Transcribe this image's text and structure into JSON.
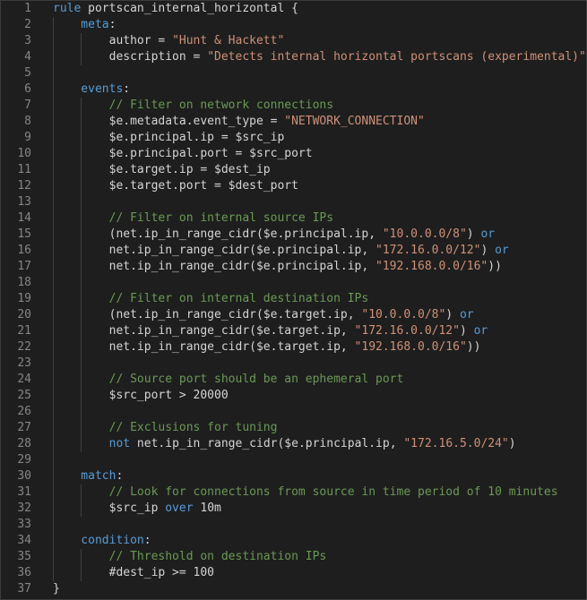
{
  "editor": {
    "colors": {
      "background": "#1e1e1e",
      "line_number": "#858585",
      "keyword": "#569cd6",
      "string": "#ce9178",
      "comment": "#6a9955",
      "text": "#d4d4d4"
    },
    "lines": [
      {
        "num": "1",
        "tokens": [
          {
            "t": "rule",
            "c": "kw"
          },
          {
            "t": " portscan_internal_horizontal {",
            "c": "ident"
          }
        ]
      },
      {
        "num": "2",
        "tokens": [
          {
            "t": "    meta",
            "c": "kw"
          },
          {
            "t": ":",
            "c": "ident"
          }
        ]
      },
      {
        "num": "3",
        "tokens": [
          {
            "t": "        author = ",
            "c": "ident"
          },
          {
            "t": "\"Hunt & Hackett\"",
            "c": "str"
          }
        ]
      },
      {
        "num": "4",
        "tokens": [
          {
            "t": "        description = ",
            "c": "ident"
          },
          {
            "t": "\"Detects internal horizontal portscans (experimental)\"",
            "c": "str"
          }
        ]
      },
      {
        "num": "5",
        "tokens": []
      },
      {
        "num": "6",
        "tokens": [
          {
            "t": "    events",
            "c": "kw"
          },
          {
            "t": ":",
            "c": "ident"
          }
        ]
      },
      {
        "num": "7",
        "tokens": [
          {
            "t": "        // Filter on network connections",
            "c": "com"
          }
        ]
      },
      {
        "num": "8",
        "tokens": [
          {
            "t": "        $e.metadata.event_type = ",
            "c": "ident"
          },
          {
            "t": "\"NETWORK_CONNECTION\"",
            "c": "str"
          }
        ]
      },
      {
        "num": "9",
        "tokens": [
          {
            "t": "        $e.principal.ip = $src_ip",
            "c": "ident"
          }
        ]
      },
      {
        "num": "10",
        "tokens": [
          {
            "t": "        $e.principal.port = $src_port",
            "c": "ident"
          }
        ]
      },
      {
        "num": "11",
        "tokens": [
          {
            "t": "        $e.target.ip = $dest_ip",
            "c": "ident"
          }
        ]
      },
      {
        "num": "12",
        "tokens": [
          {
            "t": "        $e.target.port = $dest_port",
            "c": "ident"
          }
        ]
      },
      {
        "num": "13",
        "tokens": []
      },
      {
        "num": "14",
        "tokens": [
          {
            "t": "        // Filter on internal source IPs",
            "c": "com"
          }
        ]
      },
      {
        "num": "15",
        "tokens": [
          {
            "t": "        (net.ip_in_range_cidr($e.principal.ip, ",
            "c": "ident"
          },
          {
            "t": "\"10.0.0.0/8\"",
            "c": "str"
          },
          {
            "t": ") ",
            "c": "ident"
          },
          {
            "t": "or",
            "c": "kw"
          }
        ]
      },
      {
        "num": "16",
        "tokens": [
          {
            "t": "        net.ip_in_range_cidr($e.principal.ip, ",
            "c": "ident"
          },
          {
            "t": "\"172.16.0.0/12\"",
            "c": "str"
          },
          {
            "t": ") ",
            "c": "ident"
          },
          {
            "t": "or",
            "c": "kw"
          }
        ]
      },
      {
        "num": "17",
        "tokens": [
          {
            "t": "        net.ip_in_range_cidr($e.principal.ip, ",
            "c": "ident"
          },
          {
            "t": "\"192.168.0.0/16\"",
            "c": "str"
          },
          {
            "t": "))",
            "c": "ident"
          }
        ]
      },
      {
        "num": "18",
        "tokens": []
      },
      {
        "num": "19",
        "tokens": [
          {
            "t": "        // Filter on internal destination IPs",
            "c": "com"
          }
        ]
      },
      {
        "num": "20",
        "tokens": [
          {
            "t": "        (net.ip_in_range_cidr($e.target.ip, ",
            "c": "ident"
          },
          {
            "t": "\"10.0.0.0/8\"",
            "c": "str"
          },
          {
            "t": ") ",
            "c": "ident"
          },
          {
            "t": "or",
            "c": "kw"
          }
        ]
      },
      {
        "num": "21",
        "tokens": [
          {
            "t": "        net.ip_in_range_cidr($e.target.ip, ",
            "c": "ident"
          },
          {
            "t": "\"172.16.0.0/12\"",
            "c": "str"
          },
          {
            "t": ") ",
            "c": "ident"
          },
          {
            "t": "or",
            "c": "kw"
          }
        ]
      },
      {
        "num": "22",
        "tokens": [
          {
            "t": "        net.ip_in_range_cidr($e.target.ip, ",
            "c": "ident"
          },
          {
            "t": "\"192.168.0.0/16\"",
            "c": "str"
          },
          {
            "t": "))",
            "c": "ident"
          }
        ]
      },
      {
        "num": "23",
        "tokens": []
      },
      {
        "num": "24",
        "tokens": [
          {
            "t": "        // Source port should be an ephemeral port",
            "c": "com"
          }
        ]
      },
      {
        "num": "25",
        "tokens": [
          {
            "t": "        $src_port > 20000",
            "c": "ident"
          }
        ]
      },
      {
        "num": "26",
        "tokens": []
      },
      {
        "num": "27",
        "tokens": [
          {
            "t": "        // Exclusions for tuning",
            "c": "com"
          }
        ]
      },
      {
        "num": "28",
        "tokens": [
          {
            "t": "        ",
            "c": "ident"
          },
          {
            "t": "not",
            "c": "kw"
          },
          {
            "t": " net.ip_in_range_cidr($e.principal.ip, ",
            "c": "ident"
          },
          {
            "t": "\"172.16.5.0/24\"",
            "c": "str"
          },
          {
            "t": ")",
            "c": "ident"
          }
        ]
      },
      {
        "num": "29",
        "tokens": []
      },
      {
        "num": "30",
        "tokens": [
          {
            "t": "    match",
            "c": "kw"
          },
          {
            "t": ":",
            "c": "ident"
          }
        ]
      },
      {
        "num": "31",
        "tokens": [
          {
            "t": "        // Look for connections from source in time period of 10 minutes",
            "c": "com"
          }
        ]
      },
      {
        "num": "32",
        "tokens": [
          {
            "t": "        $src_ip ",
            "c": "ident"
          },
          {
            "t": "over",
            "c": "kw"
          },
          {
            "t": " 10m",
            "c": "ident"
          }
        ]
      },
      {
        "num": "33",
        "tokens": []
      },
      {
        "num": "34",
        "tokens": [
          {
            "t": "    condition",
            "c": "kw"
          },
          {
            "t": ":",
            "c": "ident"
          }
        ]
      },
      {
        "num": "35",
        "tokens": [
          {
            "t": "        // Threshold on destination IPs",
            "c": "com"
          }
        ]
      },
      {
        "num": "36",
        "tokens": [
          {
            "t": "        #dest_ip >= 100",
            "c": "ident"
          }
        ]
      },
      {
        "num": "37",
        "tokens": [
          {
            "t": "}",
            "c": "ident"
          }
        ]
      }
    ]
  }
}
